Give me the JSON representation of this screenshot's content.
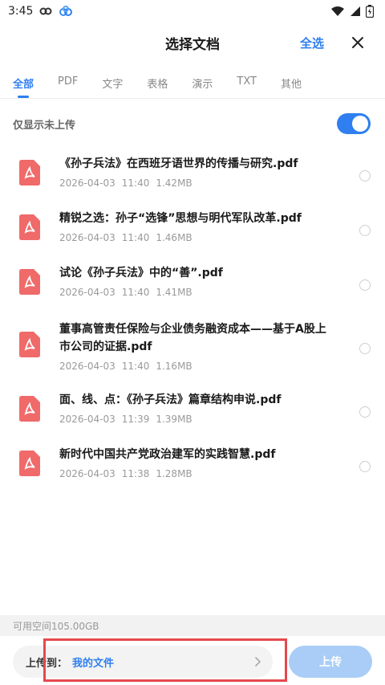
{
  "status": {
    "time": "3:45"
  },
  "header": {
    "title": "选择文档",
    "select_all": "全选"
  },
  "tabs": [
    {
      "label": "全部",
      "active": true
    },
    {
      "label": "PDF"
    },
    {
      "label": "文字"
    },
    {
      "label": "表格"
    },
    {
      "label": "演示"
    },
    {
      "label": "TXT"
    },
    {
      "label": "其他"
    }
  ],
  "filter": {
    "label": "仅显示未上传",
    "enabled": true
  },
  "files": [
    {
      "name_lines": [
        "《孙子兵法》在西班牙语世界的传播与研究.pdf"
      ],
      "date": "2026-04-03",
      "time": "11:40",
      "size": "1.42MB"
    },
    {
      "name_lines": [
        "精锐之选：孙子“选锋”思想与明代军队改革.pdf"
      ],
      "date": "2026-04-03",
      "time": "11:40",
      "size": "1.46MB"
    },
    {
      "name_lines": [
        "试论《孙子兵法》中的“善”.pdf"
      ],
      "date": "2026-04-03",
      "time": "11:40",
      "size": "1.41MB"
    },
    {
      "name_lines": [
        "董事高管责任保险与企业债务融资成本——基于A股上",
        "市公司的证据.pdf"
      ],
      "date": "2026-04-03",
      "time": "11:40",
      "size": "1.16MB"
    },
    {
      "name_lines": [
        "面、线、点：《孙子兵法》篇章结构申说.pdf"
      ],
      "date": "2026-04-03",
      "time": "11:39",
      "size": "1.39MB"
    },
    {
      "name_lines": [
        "新时代中国共产党政治建军的实践智慧.pdf"
      ],
      "date": "2026-04-03",
      "time": "11:38",
      "size": "1.28MB"
    }
  ],
  "storage": {
    "text": "可用空间105.00GB"
  },
  "bottom": {
    "dest_label": "上传到：",
    "dest_value": "我的文件",
    "upload_label": "上传"
  },
  "colors": {
    "accent": "#2f7ff0",
    "pdf_icon": "#f06a6a",
    "highlight": "#e5484d",
    "upload_disabled": "#a9cdf6"
  },
  "icons": {
    "pdf": "pdf-file-icon",
    "close": "close-icon",
    "chevron": "chevron-right-icon",
    "wifi": "wifi-icon",
    "signal": "signal-icon",
    "battery": "battery-icon"
  }
}
